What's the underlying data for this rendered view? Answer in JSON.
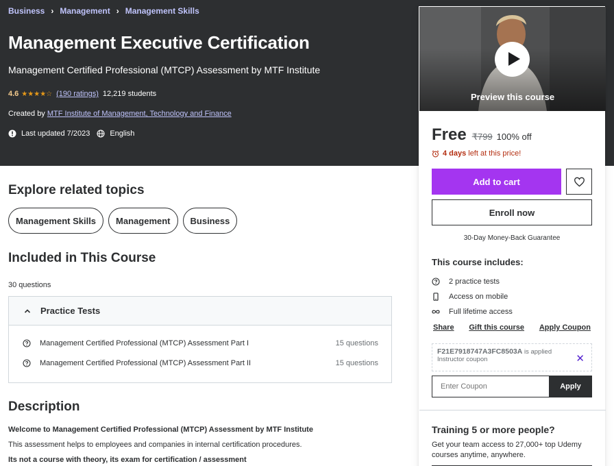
{
  "breadcrumb": [
    "Business",
    "Management",
    "Management Skills"
  ],
  "course": {
    "title": "Management Executive Certification",
    "subtitle": "Management Certified Professional (MTCP) Assessment by MTF Institute",
    "rating": "4.6",
    "stars": "★★★★☆",
    "rating_count": "(190 ratings)",
    "students": "12,219 students",
    "created_by_label": "Created by",
    "author": "MTF Institute of Management, Technology and Finance",
    "last_updated": "Last updated 7/2023",
    "language": "English"
  },
  "sidebar": {
    "preview_label": "Preview this course",
    "price": "Free",
    "original_price": "₹799",
    "discount": "100% off",
    "urgency_days": "4 days",
    "urgency_rest": "left at this price!",
    "add_to_cart": "Add to cart",
    "enroll": "Enroll now",
    "guarantee": "30-Day Money-Back Guarantee",
    "includes_title": "This course includes:",
    "includes": [
      {
        "icon": "question-icon",
        "label": "2 practice tests"
      },
      {
        "icon": "mobile-icon",
        "label": "Access on mobile"
      },
      {
        "icon": "infinity-icon",
        "label": "Full lifetime access"
      }
    ],
    "links": [
      "Share",
      "Gift this course",
      "Apply Coupon"
    ],
    "coupon_code": "F21E7918747A3FC8503A",
    "coupon_applied_text": "is applied",
    "coupon_type": "Instructor coupon",
    "coupon_placeholder": "Enter Coupon",
    "apply_label": "Apply",
    "training_title": "Training 5 or more people?",
    "training_desc": "Get your team access to 27,000+ top Udemy courses anytime, anywhere."
  },
  "related": {
    "title": "Explore related topics",
    "topics": [
      "Management Skills",
      "Management",
      "Business"
    ]
  },
  "included": {
    "title": "Included in This Course",
    "question_count": "30 questions",
    "section": "Practice Tests",
    "items": [
      {
        "label": "Management Certified Professional (MTCP) Assessment Part I",
        "questions": "15 questions"
      },
      {
        "label": "Management Certified Professional (MTCP) Assessment Part II",
        "questions": "15 questions"
      }
    ]
  },
  "description": {
    "title": "Description",
    "line1": "Welcome to Management Certified Professional (MTCP) Assessment by MTF Institute",
    "line2": "This assessment helps to employees and companies in internal certification procedures.",
    "line3": "Its not a course with theory, its exam for certification / assessment"
  },
  "colors": {
    "hero_bg": "#2d2f31",
    "link": "#c0c4fc",
    "accent": "#a435f0",
    "star": "#e59819",
    "urgency": "#b32d0f"
  }
}
